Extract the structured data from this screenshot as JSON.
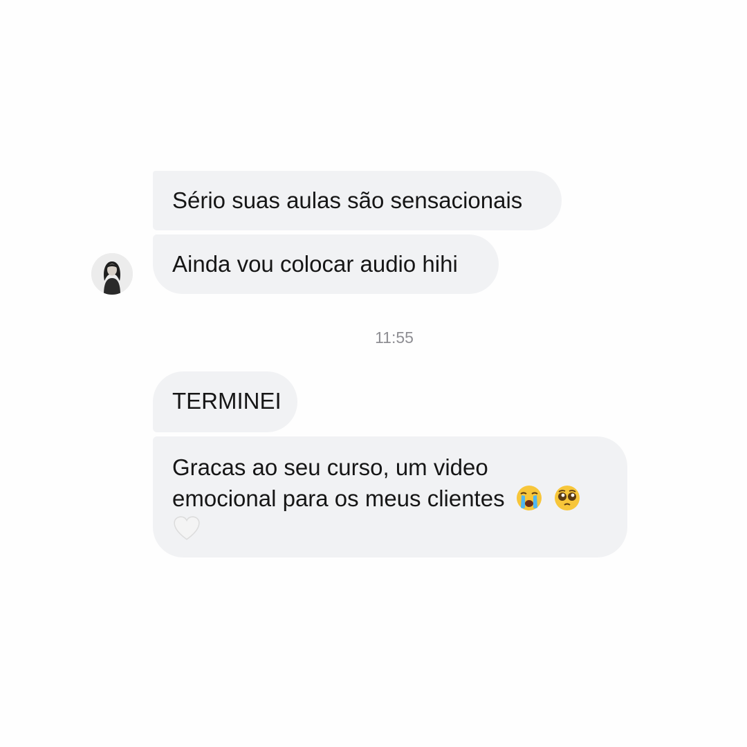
{
  "conversation": {
    "messages_before": [
      {
        "text": "Sério suas aulas são sensacionais"
      },
      {
        "text": "Ainda vou colocar audio hihi"
      }
    ],
    "timestamp": "11:55",
    "messages_after": [
      {
        "text": "TERMINEI"
      },
      {
        "line1": "Gracas ao seu curso, um video",
        "line2": "emocional para os meus clientes",
        "emojis": [
          "loudly-crying-face",
          "pleading-face",
          "white-heart"
        ]
      }
    ]
  },
  "sender": {
    "avatar_icon": "user-avatar-photo"
  },
  "colors": {
    "bubble_background": "#f1f2f4",
    "text": "#161616",
    "timestamp": "#8e8e93",
    "page_background": "#fefefe"
  }
}
